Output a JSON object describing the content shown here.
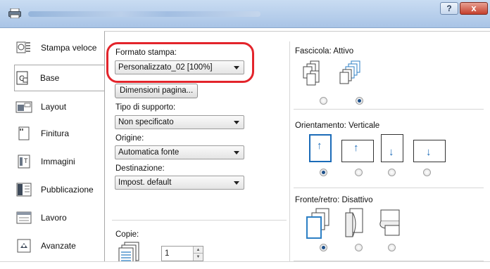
{
  "titlebar": {
    "help_label": "?",
    "close_label": "x"
  },
  "nav": {
    "items": [
      {
        "label": "Stampa veloce",
        "icon": "quick-print-icon"
      },
      {
        "label": "Base",
        "icon": "basic-icon"
      },
      {
        "label": "Layout",
        "icon": "layout-icon"
      },
      {
        "label": "Finitura",
        "icon": "finishing-icon"
      },
      {
        "label": "Immagini",
        "icon": "imaging-icon"
      },
      {
        "label": "Pubblicazione",
        "icon": "publishing-icon"
      },
      {
        "label": "Lavoro",
        "icon": "job-icon"
      },
      {
        "label": "Avanzate",
        "icon": "advanced-icon"
      }
    ],
    "active": "Base"
  },
  "base": {
    "formato_label": "Formato stampa:",
    "formato_value": "Personalizzato_02 [100%]",
    "dimensioni_button": "Dimensioni pagina...",
    "tipo_label": "Tipo di supporto:",
    "tipo_value": "Non specificato",
    "origine_label": "Origine:",
    "origine_value": "Automatica fonte",
    "destinazione_label": "Destinazione:",
    "destinazione_value": "Impost. default",
    "copie_label": "Copie:",
    "copie_value": "1"
  },
  "right": {
    "fascicola_label": "Fascicola:",
    "fascicola_value": "Attivo",
    "orientamento_label": "Orientamento:",
    "orientamento_value": "Verticale",
    "fronte_label": "Fronte/retro:",
    "fronte_value": "Disattivo"
  },
  "colors": {
    "highlight": "#e3242b",
    "accent": "#1b6bb8"
  }
}
